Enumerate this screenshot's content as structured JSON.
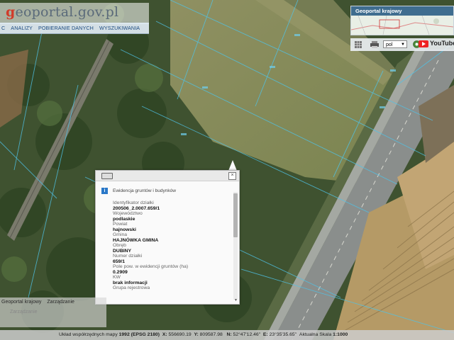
{
  "app": {
    "logo_prefix": "g",
    "logo_rest": "eoportal.gov.pl"
  },
  "menu": {
    "items": [
      "C",
      "ANALIZY",
      "POBIERANIE DANYCH",
      "WYSZUKIWANIA"
    ]
  },
  "overview": {
    "title": "Geoportal krajowy"
  },
  "toolbar": {
    "icons": [
      "grid-icon",
      "print-icon",
      "language-select",
      "globe-icon",
      "youtube-icon"
    ],
    "language_value": "pol",
    "youtube_label": "YouTube"
  },
  "popup": {
    "title": "Ewidencja gruntów i budynków",
    "info_symbol": "i",
    "close_symbol": "×",
    "fields": [
      {
        "label": "Identyfikator działki",
        "value": "200506_2.0007.659/1"
      },
      {
        "label": "Województwo",
        "value": "podlaskie"
      },
      {
        "label": "Powiat",
        "value": "hajnowski"
      },
      {
        "label": "Gmina",
        "value": "HAJNÓWKA GMINA"
      },
      {
        "label": "Obręb",
        "value": "DUBINY"
      },
      {
        "label": "Numer działki",
        "value": "659/1"
      },
      {
        "label": "Pole pow. w ewidencji gruntów (ha)",
        "value": "0.2909"
      },
      {
        "label": "KW",
        "value": "brak informacji"
      },
      {
        "label": "Grupa rejestrowa",
        "value": ""
      }
    ]
  },
  "layers": {
    "tab1": "Geoportal krajowy",
    "tab2": "Zarządzanie",
    "sub": "Zarządzanie"
  },
  "status": {
    "coord_label": "Układ współrzędnych mapy",
    "coord_value": "1992 (EPSG 2180)",
    "x_label": "X:",
    "x_value": "556690.19",
    "y_label": "Y:",
    "y_value": "809587.98",
    "n_label": "N:",
    "n_value": "52°47'12.46\"",
    "e_label": "E:",
    "e_value": "23°35'35.65\"",
    "scale_label": "Aktualna Skala",
    "scale_value": "1:1000"
  },
  "colors": {
    "accent": "#1a4a80",
    "header_bar": "#3f6d8f",
    "logo_red": "#d13b2a"
  }
}
